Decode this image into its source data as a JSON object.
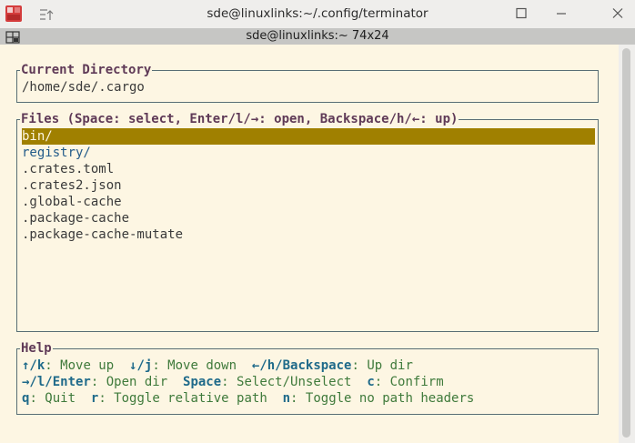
{
  "window": {
    "title": "sde@linuxlinks:~/.config/terminator",
    "icon": "terminator-app-icon"
  },
  "terminal_bar": {
    "title": "sde@linuxlinks:~ 74x24"
  },
  "current_directory": {
    "label": "Current Directory",
    "path": "/home/sde/.cargo"
  },
  "files": {
    "label": "Files (Space: select, Enter/l/→: open, Backspace/h/←: up)",
    "items": [
      {
        "name": "bin/",
        "type": "dir",
        "selected": true
      },
      {
        "name": "registry/",
        "type": "dir",
        "selected": false
      },
      {
        "name": ".crates.toml",
        "type": "file",
        "selected": false
      },
      {
        "name": ".crates2.json",
        "type": "file",
        "selected": false
      },
      {
        "name": ".global-cache",
        "type": "file",
        "selected": false
      },
      {
        "name": ".package-cache",
        "type": "file",
        "selected": false
      },
      {
        "name": ".package-cache-mutate",
        "type": "file",
        "selected": false
      }
    ]
  },
  "help": {
    "label": "Help",
    "lines": [
      [
        {
          "key": "↑/k",
          "text": ": Move up  "
        },
        {
          "key": "↓/j",
          "text": ": Move down  "
        },
        {
          "key": "←/h/Backspace",
          "text": ": Up dir"
        }
      ],
      [
        {
          "key": "→/l/Enter",
          "text": ": Open dir  "
        },
        {
          "key": "Space",
          "text": ": Select/Unselect  "
        },
        {
          "key": "c",
          "text": ": Confirm"
        }
      ],
      [
        {
          "key": "q",
          "text": ": Quit  "
        },
        {
          "key": "r",
          "text": ": Toggle relative path  "
        },
        {
          "key": "n",
          "text": ": Toggle no path headers"
        }
      ]
    ]
  },
  "colors": {
    "terminal_bg": "#fdf6e3",
    "selection_bg": "#a08000",
    "key_color": "#1f6a8a",
    "help_text": "#3f7a3b",
    "dir_color": "#245c8a",
    "box_title": "#5f3a57"
  }
}
